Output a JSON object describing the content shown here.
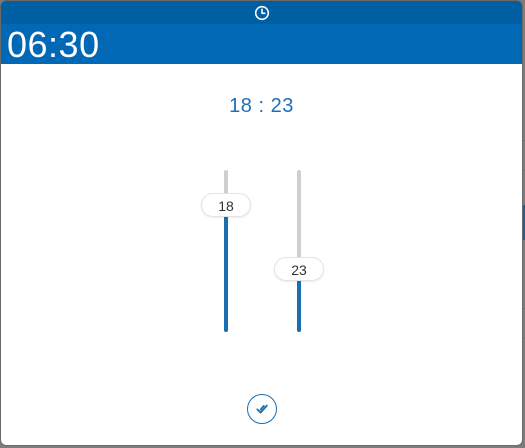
{
  "dialog": {
    "header_time": "06:30",
    "selected_time": "18 : 23"
  },
  "sliders": {
    "hours": {
      "label": "18",
      "value": 18,
      "min": 0,
      "max": 23
    },
    "minutes": {
      "label": "23",
      "value": 23,
      "min": 0,
      "max": 59
    }
  },
  "icons": {
    "header": "clock-icon",
    "confirm": "check-circle-icon"
  },
  "colors": {
    "header_bg": "#0068b4",
    "accent": "#1a6fae",
    "track": "#cfcfcf"
  }
}
